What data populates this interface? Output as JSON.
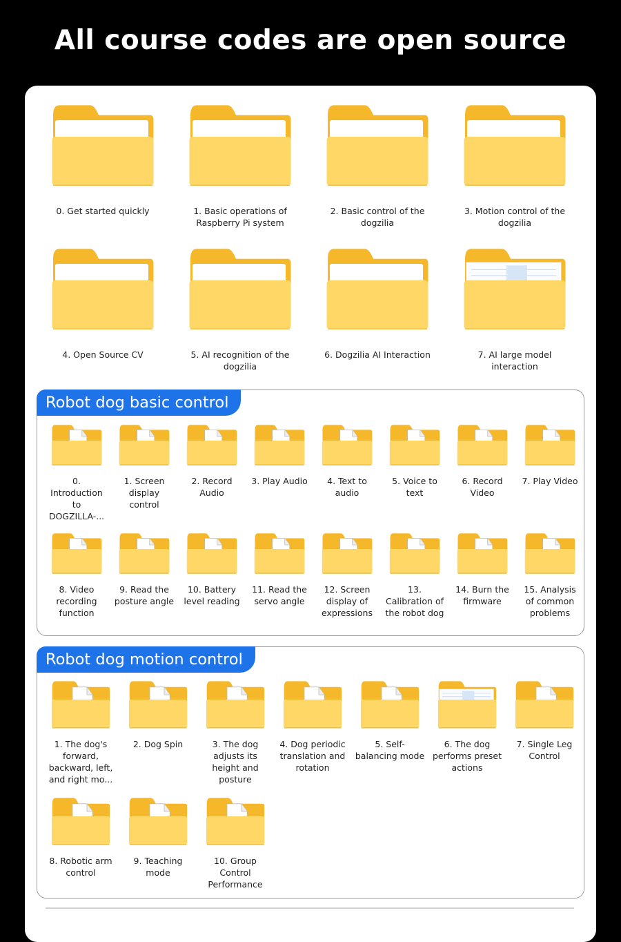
{
  "header": {
    "title": "All course codes are open source"
  },
  "top_folders": [
    {
      "label": "0. Get started quickly",
      "icon": "folder-icon"
    },
    {
      "label": "1. Basic operations of Raspberry Pi system",
      "icon": "folder-icon"
    },
    {
      "label": "2. Basic control of the dogzilia",
      "icon": "folder-icon"
    },
    {
      "label": "3. Motion control of the dogzilia",
      "icon": "folder-icon"
    },
    {
      "label": "4. Open Source CV",
      "icon": "folder-icon"
    },
    {
      "label": "5. AI recognition of the dogzilia",
      "icon": "folder-icon"
    },
    {
      "label": "6. Dogzilia AI Interaction",
      "icon": "folder-icon"
    },
    {
      "label": "7. AI large model interaction",
      "icon": "folder-with-document-icon"
    }
  ],
  "basic_control": {
    "title": "Robot dog basic control",
    "items": [
      {
        "label": "0. Introduction to DOGZILLA-...",
        "icon": "folder-with-pdf-icon"
      },
      {
        "label": "1. Screen display control",
        "icon": "folder-with-pdf-icon"
      },
      {
        "label": "2. Record Audio",
        "icon": "folder-with-pdf-icon"
      },
      {
        "label": "3. Play Audio",
        "icon": "folder-with-pdf-icon"
      },
      {
        "label": "4. Text to audio",
        "icon": "folder-with-pdf-icon"
      },
      {
        "label": "5. Voice to text",
        "icon": "folder-with-pdf-icon"
      },
      {
        "label": "6. Record Video",
        "icon": "folder-with-pdf-icon"
      },
      {
        "label": "7. Play Video",
        "icon": "folder-with-pdf-icon"
      },
      {
        "label": "8. Video recording function",
        "icon": "folder-with-pdf-icon"
      },
      {
        "label": "9. Read the posture angle",
        "icon": "folder-with-pdf-icon"
      },
      {
        "label": "10. Battery level reading",
        "icon": "folder-with-pdf-icon"
      },
      {
        "label": "11. Read the servo angle",
        "icon": "folder-with-pdf-icon"
      },
      {
        "label": "12. Screen display of expressions",
        "icon": "folder-with-pdf-icon"
      },
      {
        "label": "13. Calibration of the robot dog",
        "icon": "folder-with-pdf-icon"
      },
      {
        "label": "14. Burn the firmware",
        "icon": "folder-with-file-icon"
      },
      {
        "label": "15. Analysis of common problems",
        "icon": "folder-with-pdf-icon"
      }
    ]
  },
  "motion_control": {
    "title": "Robot dog motion control",
    "items": [
      {
        "label": "1. The dog's forward, backward, left, and right mo...",
        "icon": "folder-with-pdf-icon"
      },
      {
        "label": "2. Dog Spin",
        "icon": "folder-with-file-icon"
      },
      {
        "label": "3. The dog adjusts its height and posture",
        "icon": "folder-with-pdf-icon"
      },
      {
        "label": "4. Dog periodic translation and rotation",
        "icon": "folder-with-pdf-icon"
      },
      {
        "label": "5. Self-balancing mode",
        "icon": "folder-with-file-icon"
      },
      {
        "label": "6. The dog performs preset actions",
        "icon": "folder-with-document-icon"
      },
      {
        "label": "7. Single Leg Control",
        "icon": "folder-with-pdf-icon"
      },
      {
        "label": "8. Robotic arm control",
        "icon": "folder-with-pdf-icon"
      },
      {
        "label": "9. Teaching mode",
        "icon": "folder-with-file-icon"
      },
      {
        "label": "10. Group Control Performance",
        "icon": "folder-with-pdf-icon"
      }
    ]
  },
  "colors": {
    "folder_back": "#f5b82a",
    "folder_front": "#ffd766",
    "accent_blue": "#1f73e8",
    "pdf_red": "#d9302a"
  }
}
